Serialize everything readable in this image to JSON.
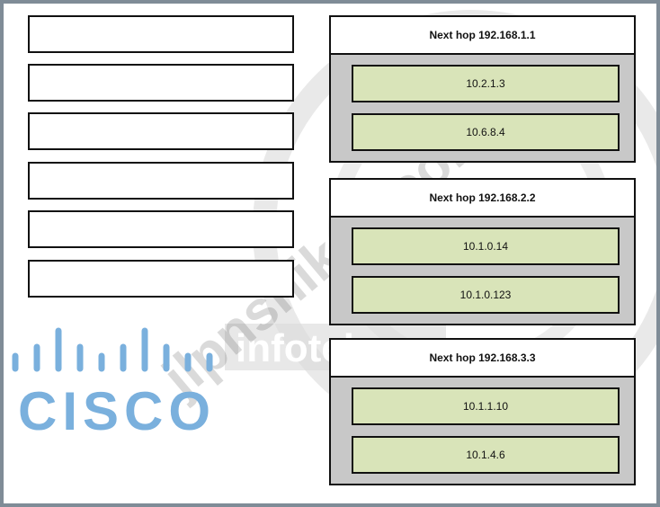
{
  "left_slots": [
    "",
    "",
    "",
    "",
    "",
    ""
  ],
  "groups": [
    {
      "header": "Next hop 192.168.1.1",
      "items": [
        "10.2.1.3",
        "10.6.8.4"
      ]
    },
    {
      "header": "Next hop 192.168.2.2",
      "items": [
        "10.1.0.14",
        "10.1.0.123"
      ]
    },
    {
      "header": "Next hop 192.168.3.3",
      "items": [
        "10.1.1.10",
        "10.1.4.6"
      ]
    }
  ],
  "logo": {
    "word": "CISCO",
    "color": "#7ab0dd"
  },
  "watermarks": [
    "jlpnshiken.com",
    "infotek"
  ]
}
